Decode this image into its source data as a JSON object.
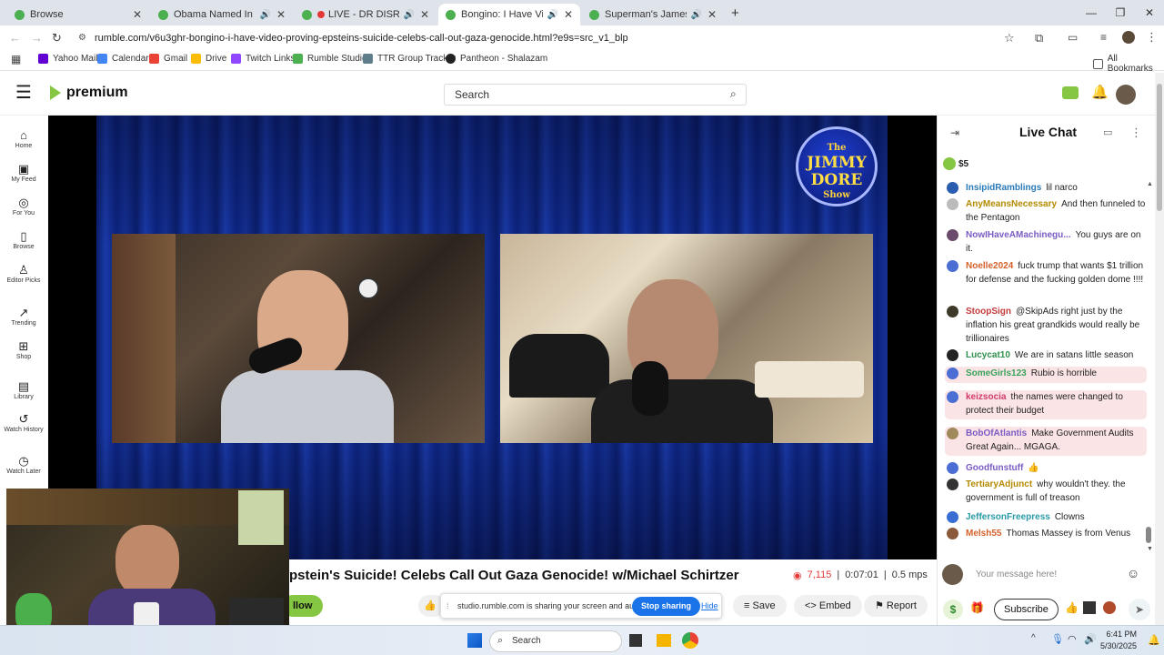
{
  "browser": {
    "tabs": [
      {
        "title": "Browse",
        "color": "#4caf50"
      },
      {
        "title": "Obama Named In Diddy Tr",
        "color": "#4caf50"
      },
      {
        "title": "LIVE - DR DISRESPECT -",
        "color": "#e53935"
      },
      {
        "title": "Bongino: I Have Video PRO",
        "color": "#4caf50"
      },
      {
        "title": "Superman's James Gunn Re",
        "color": "#4caf50"
      }
    ],
    "url": "rumble.com/v6u3ghr-bongino-i-have-video-proving-epsteins-suicide-celebs-call-out-gaza-genocide.html?e9s=src_v1_blp",
    "bookmarks": [
      "Yahoo Mail",
      "Calendar",
      "Gmail",
      "Drive",
      "Twitch Links",
      "Rumble Studio",
      "TTR Group Tracker",
      "Pantheon - Shalazam"
    ],
    "all_bookmarks": "All Bookmarks"
  },
  "site": {
    "logo_text": "premium",
    "search_placeholder": "Search",
    "nav": [
      {
        "label": "Home",
        "icon": "home-icon",
        "glyph": "⌂"
      },
      {
        "label": "My Feed",
        "icon": "feed-icon",
        "glyph": "▣"
      },
      {
        "label": "For You",
        "icon": "target-icon",
        "glyph": "◎"
      },
      {
        "label": "Browse",
        "icon": "browse-icon",
        "glyph": "▯"
      },
      {
        "label": "Editor Picks",
        "icon": "award-icon",
        "glyph": "♙"
      },
      {
        "label": "Trending",
        "icon": "trending-icon",
        "glyph": "↗"
      },
      {
        "label": "Shop",
        "icon": "shop-icon",
        "glyph": "⊞"
      },
      {
        "label": "Library",
        "icon": "library-icon",
        "glyph": "▤"
      },
      {
        "label": "Watch History",
        "icon": "history-icon",
        "glyph": "↺"
      },
      {
        "label": "Watch Later",
        "icon": "clock-icon",
        "glyph": "◷"
      }
    ]
  },
  "video": {
    "logo_small": "The",
    "logo_big": "JIMMY DORE",
    "logo_sub": "Show",
    "title": "pstein's Suicide! Celebs Call Out Gaza Genocide! w/Michael Schirtzer",
    "views": "7,115",
    "duration": "0:07:01",
    "bitrate": "0.5 mps",
    "follow_label": "llow",
    "save_label": "Save",
    "embed_label": "Embed",
    "report_label": "Report"
  },
  "share_banner": {
    "text": "studio.rumble.com is sharing your screen and audio.",
    "stop": "Stop sharing",
    "hide": "Hide"
  },
  "chat": {
    "title": "Live Chat",
    "rant_amount": "$5",
    "input_placeholder": "Your message here!",
    "subscribe": "Subscribe",
    "messages": [
      {
        "user": "InsipidRamblings",
        "text": "lil narco",
        "color": "#2a7ab8",
        "av": "#2a5db0",
        "hl": false
      },
      {
        "user": "AnyMeansNecessary",
        "text": "And then funneled to the Pentagon",
        "color": "#b38a00",
        "av": "#bbbbbb",
        "hl": false
      },
      {
        "user": "NowIHaveAMachinegu...",
        "text": "You guys are on it.",
        "color": "#7b5cc4",
        "av": "#6a4b6b",
        "hl": false
      },
      {
        "user": "Noelle2024",
        "text": "fuck trump that wants $1 trillion for defense and the fucking golden dome !!!!",
        "color": "#d4612b",
        "av": "#4a6ed4",
        "hl": false
      },
      {
        "user": "StoopSign",
        "text": "@SkipAds right just by the inflation his great grandkids would really be trillionaires",
        "color": "#c43a3a",
        "av": "#3e3a2a",
        "hl": false
      },
      {
        "user": "Lucycat10",
        "text": "We are in satans little season",
        "color": "#2f8f4e",
        "av": "#222222",
        "hl": false
      },
      {
        "user": "SomeGirls123",
        "text": "Rubio is horrible",
        "color": "#3aa35a",
        "av": "#4a6ed4",
        "hl": true
      },
      {
        "user": "keizsocia",
        "text": "the names were changed to protect their budget",
        "color": "#d23a6a",
        "av": "#4a6ed4",
        "hl": true
      },
      {
        "user": "BobOfAtlantis",
        "text": "Make Government Audits Great Again... MGAGA.",
        "color": "#7b5cc4",
        "av": "#a0895a",
        "hl": true
      },
      {
        "user": "Goodfunstuff",
        "text": "👍",
        "color": "#7b5cc4",
        "av": "#4a6ed4",
        "hl": false
      },
      {
        "user": "TertiaryAdjunct",
        "text": "why wouldn't they. the government is full of treason",
        "color": "#b38a00",
        "av": "#333333",
        "hl": false
      },
      {
        "user": "JeffersonFreepress",
        "text": "Clowns",
        "color": "#2a9aa8",
        "av": "#3a6ed4",
        "hl": false
      },
      {
        "user": "Melsh55",
        "text": "Thomas Massey is from Venus",
        "color": "#d4612b",
        "av": "#8a5a3a",
        "hl": false
      }
    ]
  },
  "taskbar": {
    "search": "Search",
    "time": "6:41 PM",
    "date": "5/30/2025"
  }
}
